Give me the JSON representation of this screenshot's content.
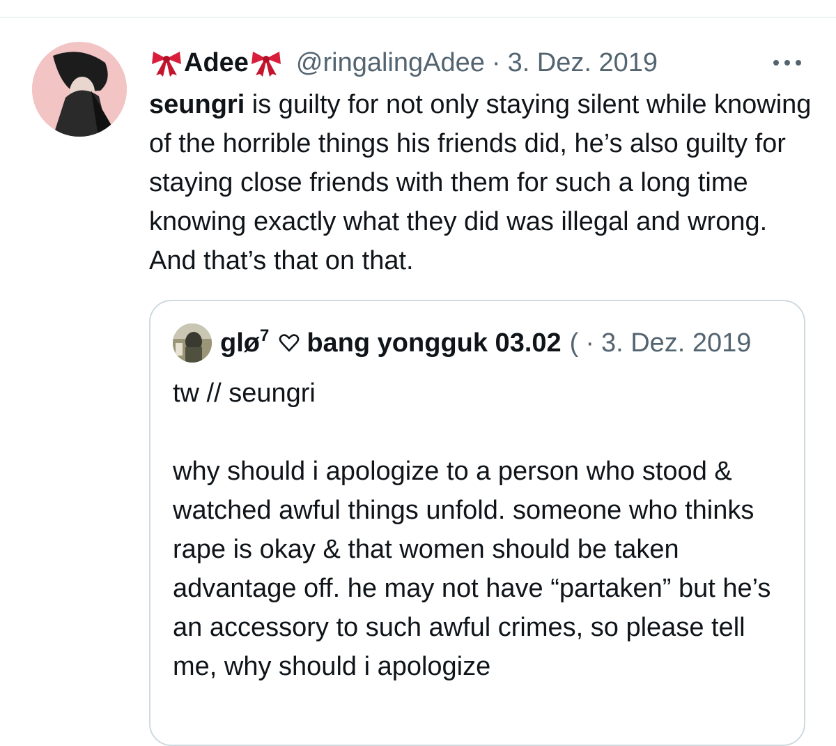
{
  "tweet": {
    "display_name": "Adee",
    "handle": "@ringalingAdee",
    "separator": "·",
    "date": "3. Dez. 2019",
    "text_bold": "seungri",
    "text_rest": " is guilty for not only staying silent while knowing of the horrible things his friends did, he’s also guilty for staying close friends with them for such a long time knowing exactly what they did was illegal and wrong. And that’s that on that.",
    "name_emoji_icon": "ribbon-bow-icon"
  },
  "quoted_tweet": {
    "display_name": "glø",
    "superscript": "7",
    "name_suffix": "bang yongguk 03.02",
    "truncated_handle": "(",
    "separator": "·",
    "date": "3. Dez. 2019",
    "text": "tw // seungri\n\nwhy should i apologize to a person who stood & watched awful things unfold. someone who thinks rape is okay & that women should be taken advantage off. he may not have “partaken” but he’s an accessory to such awful crimes, so please tell me, why should i apologize",
    "heart_icon": "heart-outline-icon"
  },
  "colors": {
    "text_primary": "#0f1419",
    "text_secondary": "#536471",
    "border": "#cfd9de",
    "bow_red": "#d81e3a"
  }
}
